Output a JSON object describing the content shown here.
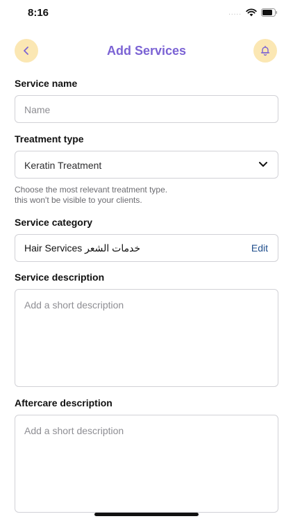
{
  "status_bar": {
    "time": "8:16",
    "signal": "....."
  },
  "nav": {
    "title": "Add Services",
    "back_icon": "chevron-left-icon",
    "bell_icon": "bell-icon",
    "button_color": "#fbe7b3",
    "title_color": "#7b63d4"
  },
  "form": {
    "service_name": {
      "label": "Service name",
      "placeholder": "Name"
    },
    "treatment_type": {
      "label": "Treatment type",
      "selected": "Keratin Treatment",
      "hint_line1": "Choose the most relevant treatment type.",
      "hint_line2": "this won't be visible to your clients."
    },
    "service_category": {
      "label": "Service category",
      "value": "Hair Services خدمات الشعر",
      "edit_label": "Edit"
    },
    "service_description": {
      "label": "Service description",
      "placeholder": "Add a short description"
    },
    "aftercare_description": {
      "label": "Aftercare description",
      "placeholder": "Add a short description"
    }
  }
}
